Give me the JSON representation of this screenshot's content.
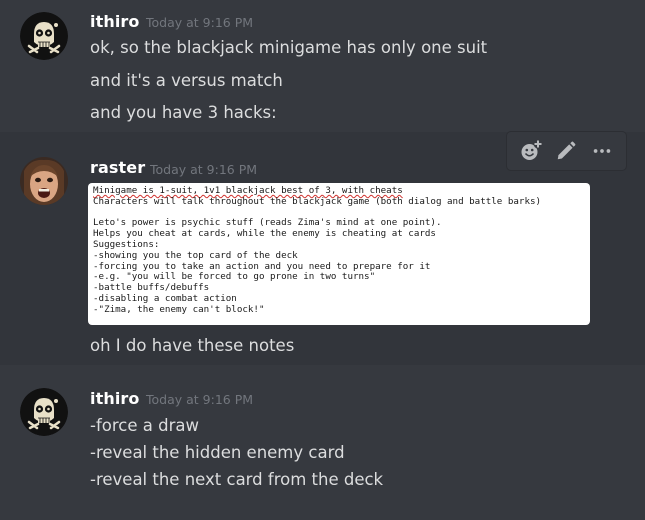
{
  "messages": [
    {
      "author": "ithiro",
      "timestamp": "Today at 9:16 PM",
      "lines": [
        "ok, so the blackjack minigame has only one suit",
        "and it's a versus match",
        "and you have 3 hacks:"
      ]
    },
    {
      "author": "raster",
      "timestamp": "Today at 9:16 PM",
      "attachment": {
        "lines": [
          "Minigame is 1-suit, 1v1 blackjack best of 3, with cheats",
          "Characters will talk throughout the blackjack game (both dialog and battle barks)",
          "",
          "Leto's power is psychic stuff (reads Zima's mind at one point).",
          "Helps you cheat at cards, while the enemy is cheating at cards",
          "Suggestions:",
          "-showing you the top card of the deck",
          "-forcing you to take an action and you need to prepare for it",
          "-e.g. \"you will be forced to go prone in two turns\"",
          "-battle buffs/debuffs",
          "-disabling a combat action",
          "-\"Zima, the enemy can't block!\""
        ]
      },
      "lines": [
        "oh I do have these notes"
      ]
    },
    {
      "author": "ithiro",
      "timestamp": "Today at 9:16 PM",
      "lines": [
        "-force a draw",
        "-reveal the hidden enemy card",
        "-reveal the next card from the deck"
      ]
    }
  ],
  "toolbar": {
    "icons": [
      "add-reaction-icon",
      "edit-pencil-icon",
      "more-options-icon"
    ]
  },
  "colors": {
    "background": "#36393f",
    "hover_background": "#32353b",
    "username": "#ffffff",
    "timestamp": "#72767d",
    "text": "#dcddde",
    "icon": "#b9bbbe"
  }
}
